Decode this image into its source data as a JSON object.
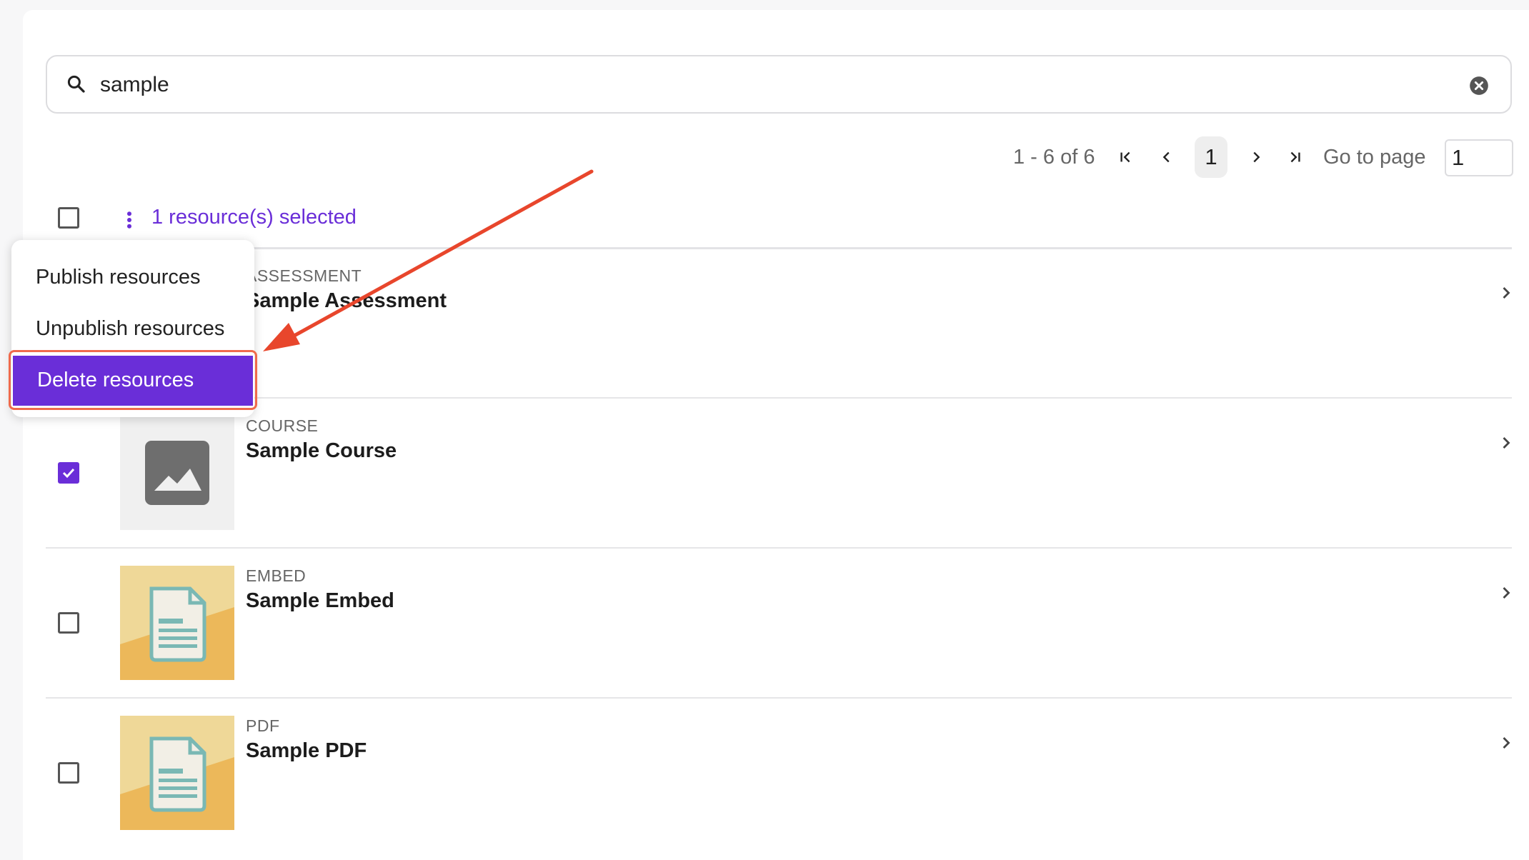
{
  "search": {
    "value": "sample",
    "placeholder": ""
  },
  "pagination": {
    "range": "1 - 6 of 6",
    "current_page": "1",
    "goto_label": "Go to page",
    "goto_value": "1"
  },
  "selection": {
    "text": "1 resource(s) selected"
  },
  "menu": {
    "items": [
      {
        "label": "Publish resources"
      },
      {
        "label": "Unpublish resources"
      },
      {
        "label": "Delete resources"
      }
    ],
    "active_index": 2
  },
  "rows": [
    {
      "type": "ASSESSMENT",
      "title": "Sample Assessment",
      "checked": false,
      "thumb": "unknown"
    },
    {
      "type": "COURSE",
      "title": "Sample Course",
      "checked": true,
      "thumb": "image-placeholder-icon"
    },
    {
      "type": "EMBED",
      "title": "Sample Embed",
      "checked": false,
      "thumb": "document-icon"
    },
    {
      "type": "PDF",
      "title": "Sample PDF",
      "checked": false,
      "thumb": "document-icon"
    }
  ],
  "colors": {
    "accent": "#6a2ed8",
    "annotation": "#e8462c",
    "thumb_light": "#efd898",
    "thumb_dark": "#ecb85a",
    "doc_teal": "#7ab8b4"
  }
}
